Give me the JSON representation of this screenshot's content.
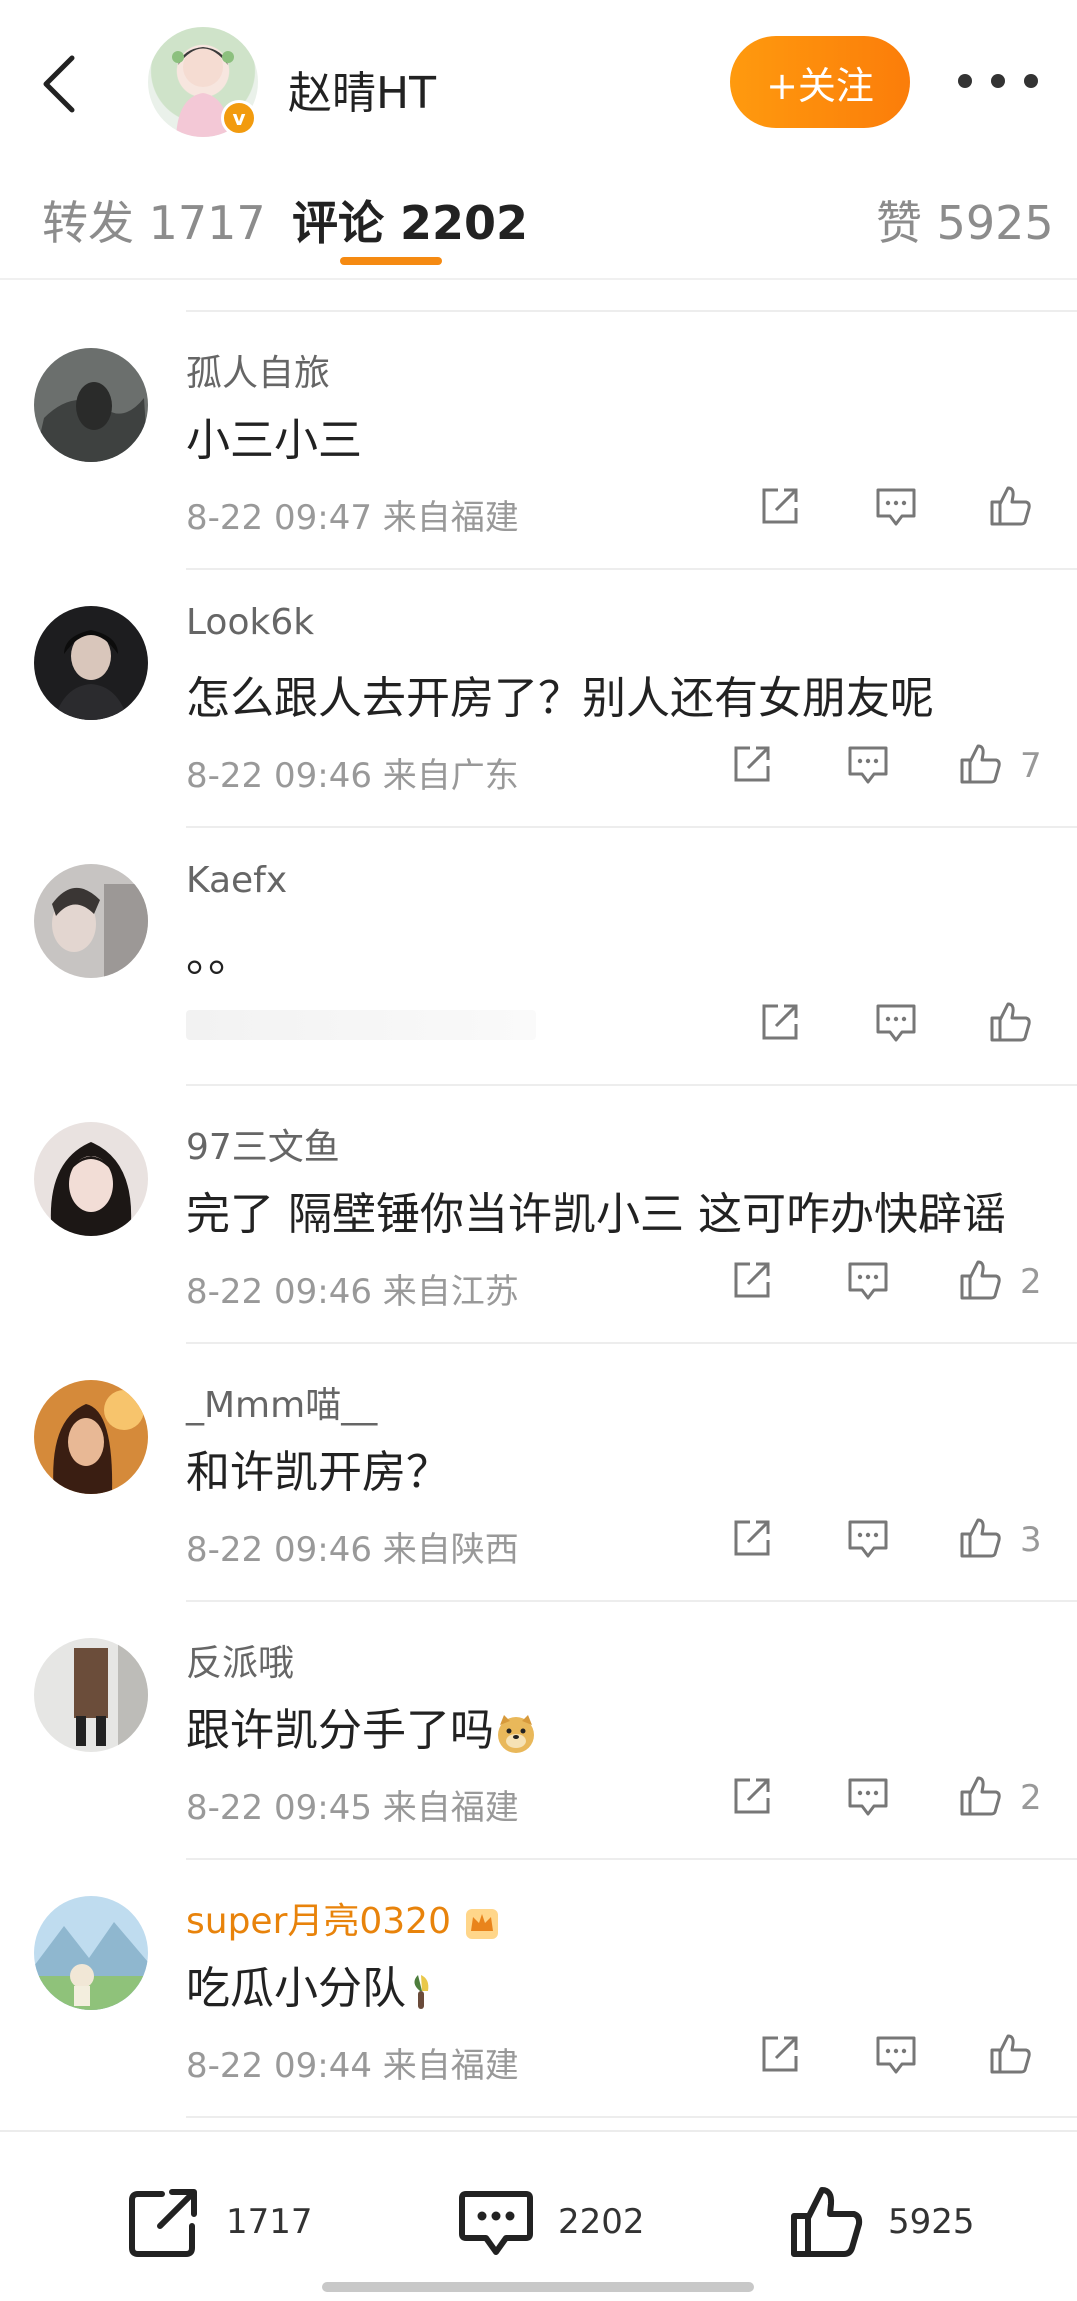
{
  "header": {
    "name": "赵晴HT",
    "follow_label": "+关注",
    "verified_mark": "v"
  },
  "tabs": [
    {
      "label": "转发 1717"
    },
    {
      "label": "评论 2202"
    },
    {
      "label": "赞 5925"
    }
  ],
  "comments": [
    {
      "user": "孤人自旅",
      "text": "小三小三",
      "meta": "8-22 09:47 来自福建",
      "likes": ""
    },
    {
      "user": "Look6k",
      "text": "怎么跟人去开房了？别人还有女朋友呢",
      "meta": "8-22 09:46 来自广东",
      "likes": "7"
    },
    {
      "user": "Kaefx",
      "text": "。。",
      "meta": "",
      "likes": ""
    },
    {
      "user": "97三文鱼",
      "text": "完了 隔壁锤你当许凯小三  这可咋办快辟谣",
      "meta": "8-22 09:46 来自江苏",
      "likes": "2"
    },
    {
      "user": "_Mmm喵__",
      "text": "和许凯开房？",
      "meta": "8-22 09:46 来自陕西",
      "likes": "3"
    },
    {
      "user": "反派哦",
      "text": "跟许凯分手了吗",
      "meta": "8-22 09:45 来自福建",
      "likes": "2"
    },
    {
      "user": "super月亮0320",
      "text": "吃瓜小分队",
      "meta": "8-22 09:44 来自福建",
      "likes": ""
    }
  ],
  "bottom_bar": {
    "repost_count": "1717",
    "comment_count": "2202",
    "like_count": "5925"
  },
  "colors": {
    "accent": "#f58a12",
    "vip_name": "#e8830b",
    "muted": "#999999"
  }
}
